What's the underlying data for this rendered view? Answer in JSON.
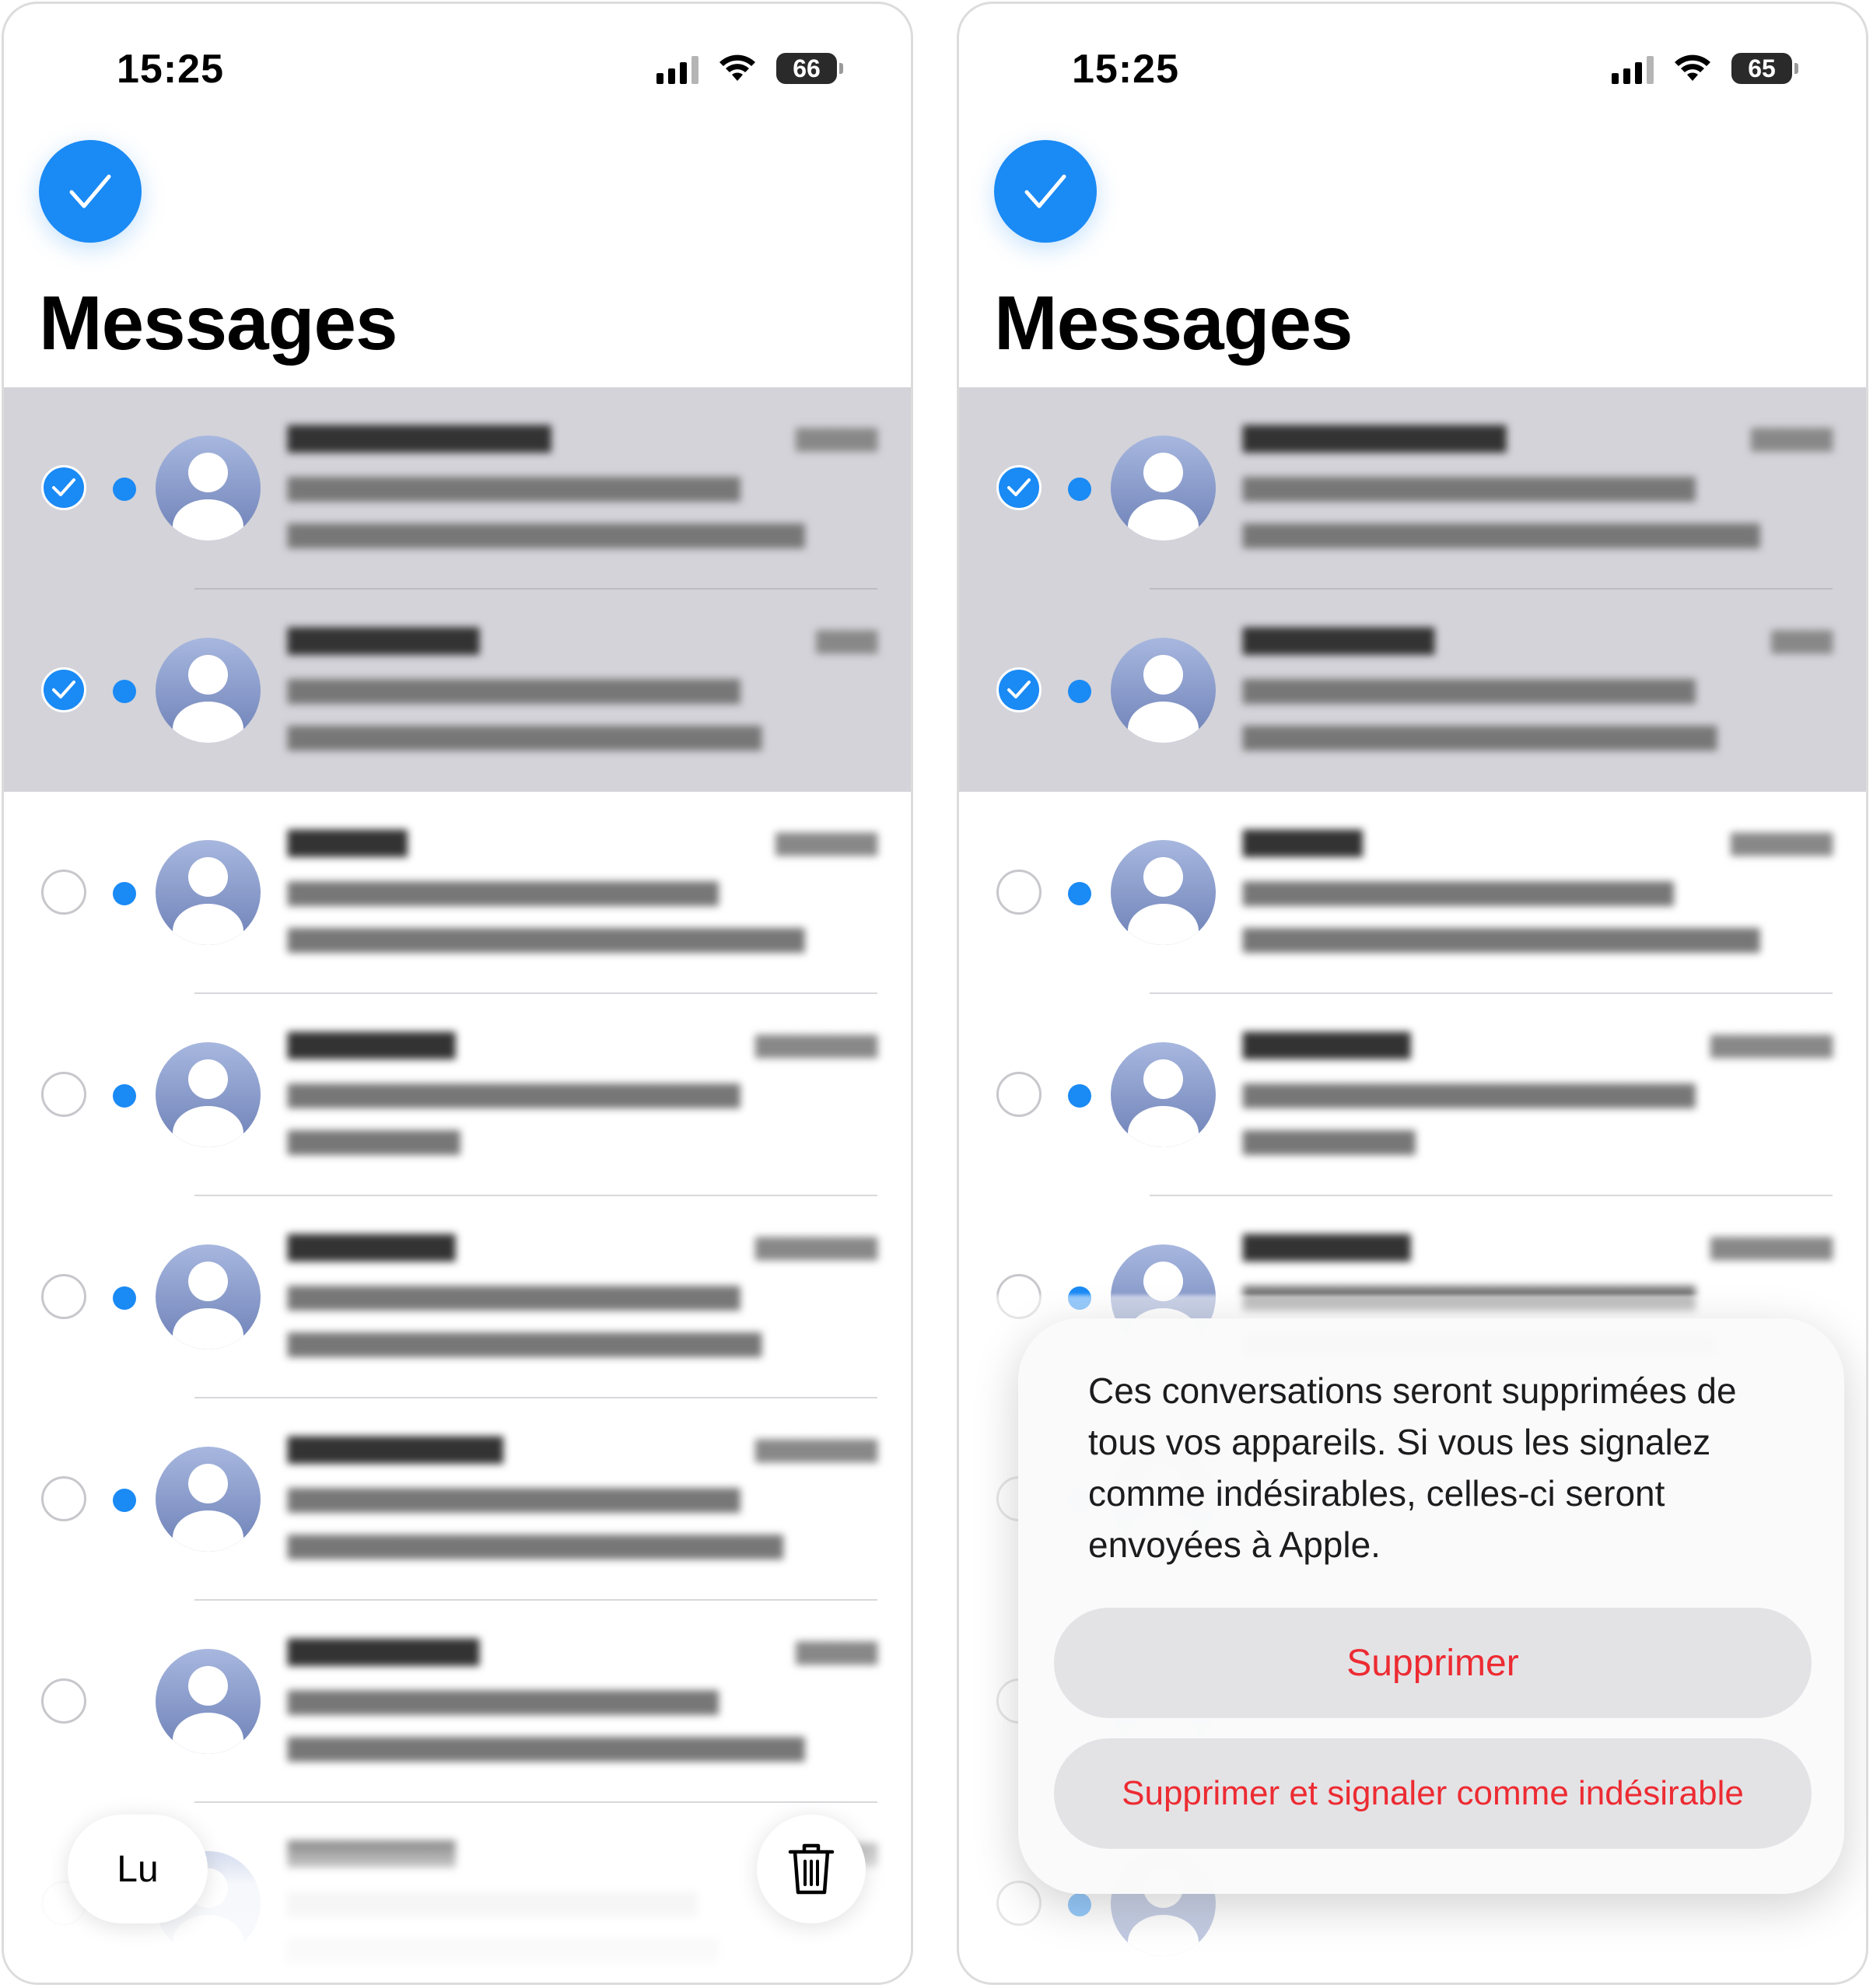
{
  "panels": [
    {
      "status": {
        "time": "15:25",
        "battery": "66"
      },
      "title": "Messages",
      "bottom_bar": {
        "read_label": "Lu"
      }
    },
    {
      "status": {
        "time": "15:25",
        "battery": "65"
      },
      "title": "Messages",
      "action_sheet": {
        "message": "Ces conversations seront supprimées de tous vos appareils. Si vous les signalez comme indésirables, celles-ci seront envoyées à Apple.",
        "delete_label": "Supprimer",
        "delete_report_label": "Supprimer et signaler comme indésirable"
      }
    }
  ],
  "conversations": [
    {
      "selected": true,
      "unread": true
    },
    {
      "selected": true,
      "unread": true
    },
    {
      "selected": false,
      "unread": true
    },
    {
      "selected": false,
      "unread": true
    },
    {
      "selected": false,
      "unread": true
    },
    {
      "selected": false,
      "unread": true
    },
    {
      "selected": false,
      "unread": false
    },
    {
      "selected": false,
      "unread": true
    }
  ],
  "colors": {
    "accent": "#1a8af5",
    "destructive": "#ed2b32",
    "selected_row": "#d3d3d9"
  },
  "icons": [
    "checkmark-icon",
    "signal-icon",
    "wifi-icon",
    "battery-icon",
    "person-avatar-icon",
    "trash-icon"
  ]
}
